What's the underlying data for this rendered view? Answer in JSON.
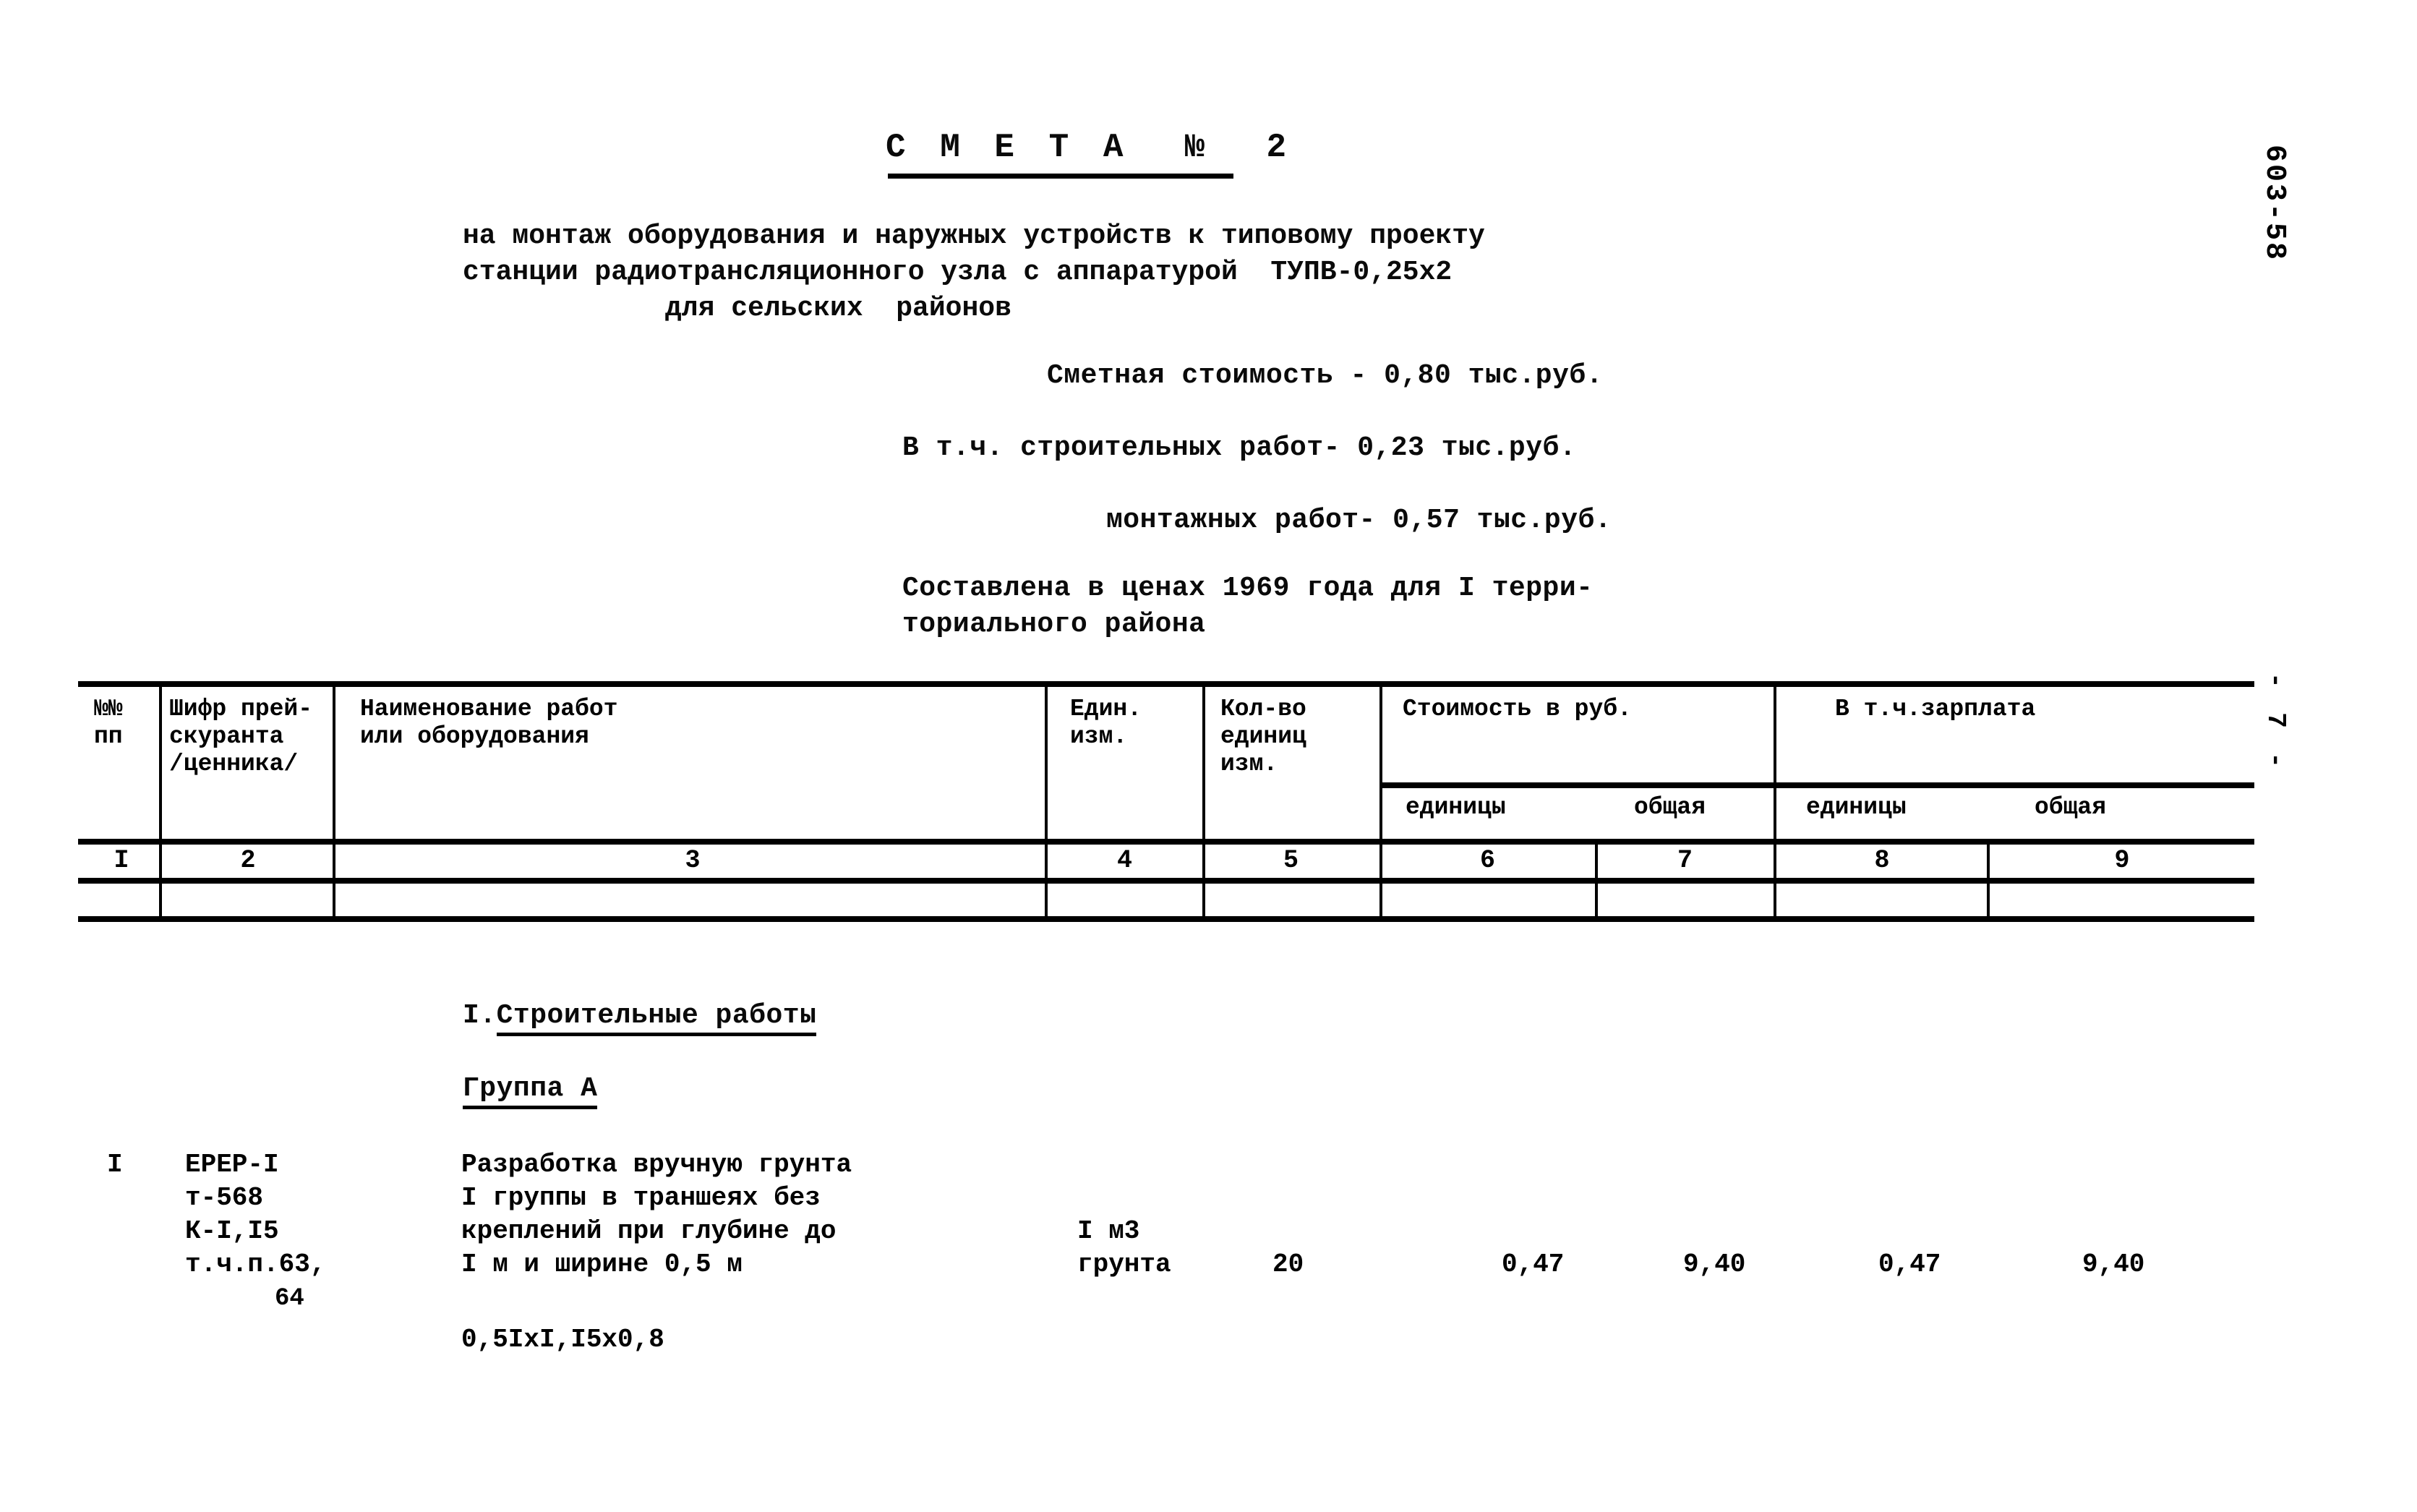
{
  "document": {
    "margin_code": "603-58",
    "page_marker": "- 7 -",
    "title": "С М Е Т А  №  2",
    "subtitle_lines": [
      "на монтаж оборудования и наружных устройств к типовому проекту",
      "станции радиотрансляционного узла с аппаратурой  ТУПВ-0,25х2",
      "для сельских  районов"
    ],
    "cost_total": "Сметная стоимость - 0,80 тыс.руб.",
    "cost_construction": "В т.ч. строительных работ- 0,23 тыс.руб.",
    "cost_installation": "монтажных работ- 0,57 тыс.руб.",
    "prices_note_1": "Составлена в ценах 1969 года для I терри-",
    "prices_note_2": "ториального района"
  },
  "table": {
    "headers": {
      "col1": "№№\nпп",
      "col2": "Шифр прей-\nскуранта\n/ценника/",
      "col3": "Наименование работ\nили оборудования",
      "col4": "Един.\nизм.",
      "col5": "Кол-во\nединиц\nизм.",
      "group_cost": "Стоимость в руб.",
      "group_salary": "В т.ч.зарплата",
      "sub_cost_unit": "единицы",
      "sub_cost_total": "общая",
      "sub_salary_unit": "единицы",
      "sub_salary_total": "общая"
    },
    "column_numbers": [
      "I",
      "2",
      "3",
      "4",
      "5",
      "6",
      "7",
      "8",
      "9"
    ]
  },
  "body": {
    "section_heading": "I.Строительные работы",
    "section_heading_prefix": "I.",
    "section_heading_underlined": "Строительные работы",
    "group_heading": "Группа А",
    "rows": [
      {
        "no": "I",
        "cipher": "ЕРЕР-I\nт-568\nК-I,I5\nт.ч.п.63,",
        "cipher_cont": "64",
        "description": "Разработка вручную грунта\nI группы в траншеях без\nкреплений при глубине до\nI м и ширине 0,5 м",
        "extra_note": "0,5IхI,I5х0,8",
        "unit": "I м3\nгрунта",
        "quantity": "20",
        "cost_unit": "0,47",
        "cost_total": "9,40",
        "salary_unit": "0,47",
        "salary_total": "9,40"
      }
    ]
  }
}
